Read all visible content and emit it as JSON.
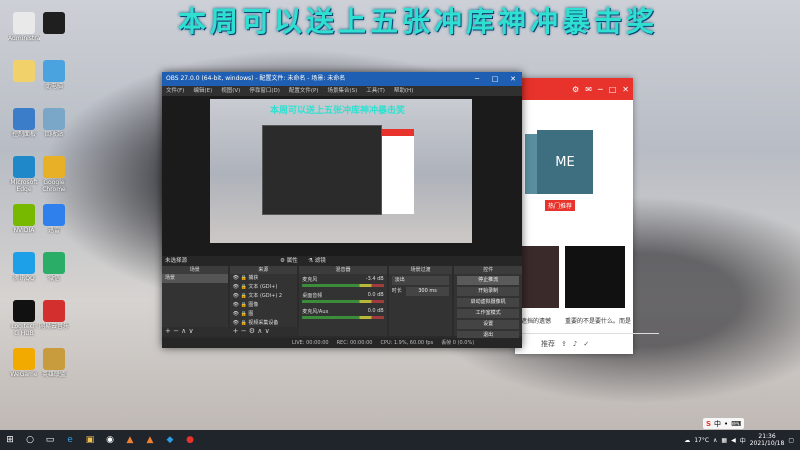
{
  "banner": "本周可以送上五张冲库神冲暴击奖",
  "desktop_icons": [
    {
      "label": "Administrator",
      "color": "#e9e9e9"
    },
    {
      "label": "",
      "color": "#1f1f1f"
    },
    {
      "label": "",
      "color": "#f1d26a"
    },
    {
      "label": "此电脑",
      "color": "#4aa3df"
    },
    {
      "label": "控制面板",
      "color": "#3b7dc8"
    },
    {
      "label": "回收站",
      "color": "#7aa6c8"
    },
    {
      "label": "Microsoft Edge",
      "color": "#1e88c8"
    },
    {
      "label": "Google Chrome",
      "color": "#e8b027"
    },
    {
      "label": "NVIDIA",
      "color": "#76b900"
    },
    {
      "label": "迅雷",
      "color": "#2f80ed"
    },
    {
      "label": "腾讯QQ",
      "color": "#1ea0e8"
    },
    {
      "label": "微信",
      "color": "#2aae67"
    },
    {
      "label": "Logitech G HUB",
      "color": "#111111"
    },
    {
      "label": "网易云音乐",
      "color": "#d32f2f"
    },
    {
      "label": "WeGame",
      "color": "#f2a900"
    },
    {
      "label": "英雄联盟",
      "color": "#c89b3c"
    }
  ],
  "obs": {
    "title": "OBS 27.0.0 (64-bit, windows) - 配置文件: 未命名 - 场景: 未命名",
    "menu": [
      "文件(F)",
      "编辑(E)",
      "视图(V)",
      "停靠窗口(D)",
      "配置文件(P)",
      "场景集合(S)",
      "工具(T)",
      "帮助(H)"
    ],
    "preview_text": "本周可以送上五张冲库神冲暴击奖",
    "no_source": "未选择源",
    "props_label": "属性",
    "filters_label": "滤镜",
    "scenes": {
      "header": "场景",
      "items": [
        "场景"
      ]
    },
    "sources": {
      "header": "来源",
      "items": [
        "捕获",
        "文本 (GDI+)",
        "文本 (GDI+) 2",
        "图像",
        "图",
        "视频采集设备"
      ]
    },
    "mixer": {
      "header": "混音器",
      "rows": [
        {
          "name": "麦克风",
          "db": "-3.4 dB"
        },
        {
          "name": "桌面音频",
          "db": "0.0 dB"
        },
        {
          "name": "麦克风/Aux",
          "db": "0.0 dB"
        }
      ]
    },
    "transitions": {
      "header": "场景过渡",
      "type": "淡出",
      "duration_label": "时长",
      "duration": "300 ms"
    },
    "controls": {
      "header": "控件",
      "buttons": [
        "停止推流",
        "开始录制",
        "启动虚拟摄像机",
        "工作室模式",
        "设置",
        "退出"
      ]
    },
    "status": [
      "LIVE: 00:00:00",
      "REC: 00:00:00",
      "CPU: 1.9%, 60.00 fps",
      "丢帧 0 (0.0%)"
    ]
  },
  "bg_app": {
    "card_label": "ME",
    "tag": "热门推荐",
    "captions": [
      "遮挡的遗憾",
      "重要的不是要什么。而是"
    ],
    "bottom_label": "推荐"
  },
  "taskbar": {
    "temperature": "17°C",
    "time": "21:36",
    "date": "2021/10/18",
    "ime": "中"
  }
}
